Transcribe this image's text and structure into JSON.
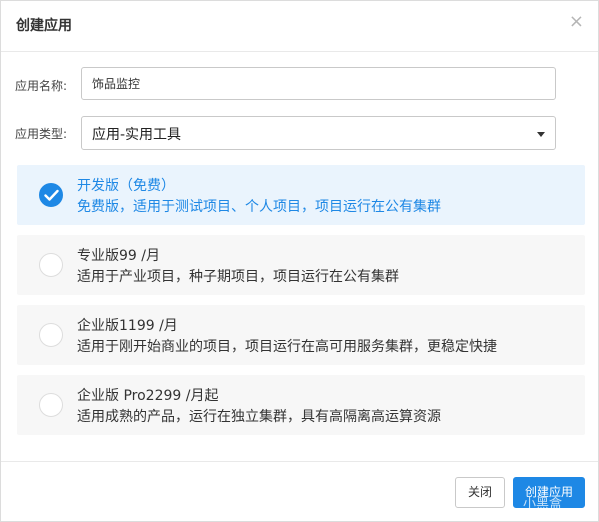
{
  "dialog": {
    "title": "创建应用",
    "close_glyph": "×"
  },
  "form": {
    "name_label": "应用名称:",
    "name_value": "饰品监控",
    "type_label": "应用类型:",
    "type_value": "应用-实用工具"
  },
  "plans": [
    {
      "name": "开发版（免费）",
      "desc": "免费版，适用于测试项目、个人项目，项目运行在公有集群",
      "selected": true
    },
    {
      "name": "专业版99 /月",
      "desc": "适用于产业项目，种子期项目，项目运行在公有集群",
      "selected": false
    },
    {
      "name": "企业版1199 /月",
      "desc": "适用于刚开始商业的项目，项目运行在高可用服务集群，更稳定快捷",
      "selected": false
    },
    {
      "name": "企业版 Pro2299 /月起",
      "desc": "适用成熟的产品，运行在独立集群，具有高隔离高运算资源",
      "selected": false
    }
  ],
  "footer": {
    "close_label": "关闭",
    "create_label": "创建应用"
  },
  "watermark": "小黑盒",
  "colors": {
    "accent": "#1e88e5",
    "selected_bg": "#eaf4fd",
    "plan_bg": "#f7f7f7"
  },
  "icons": {
    "close": "close-icon",
    "dropdown": "caret-down-icon",
    "check": "check-icon"
  }
}
